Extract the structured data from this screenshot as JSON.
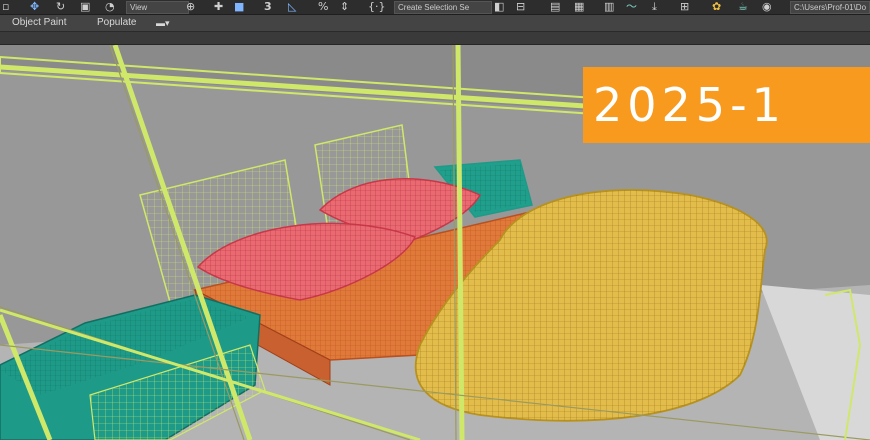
{
  "toolbar": {
    "view_dropdown": "View",
    "selection_set_dropdown": "Create Selection Se",
    "path_field": "C:\\Users\\Prof-01\\Do",
    "snap_label": "3",
    "percent_label": "%"
  },
  "ribbon": {
    "tabs": [
      "Object Paint",
      "Populate"
    ]
  },
  "badge": {
    "version": "2025-1"
  },
  "colors": {
    "accent_badge": "#f79a1e",
    "wire_frame": "#cfe86a",
    "wire_pillow": "#e8606a",
    "wire_blanket": "#d8b43a",
    "wire_mattress": "#e07a3a",
    "wire_nightstand": "#1e9a88"
  }
}
